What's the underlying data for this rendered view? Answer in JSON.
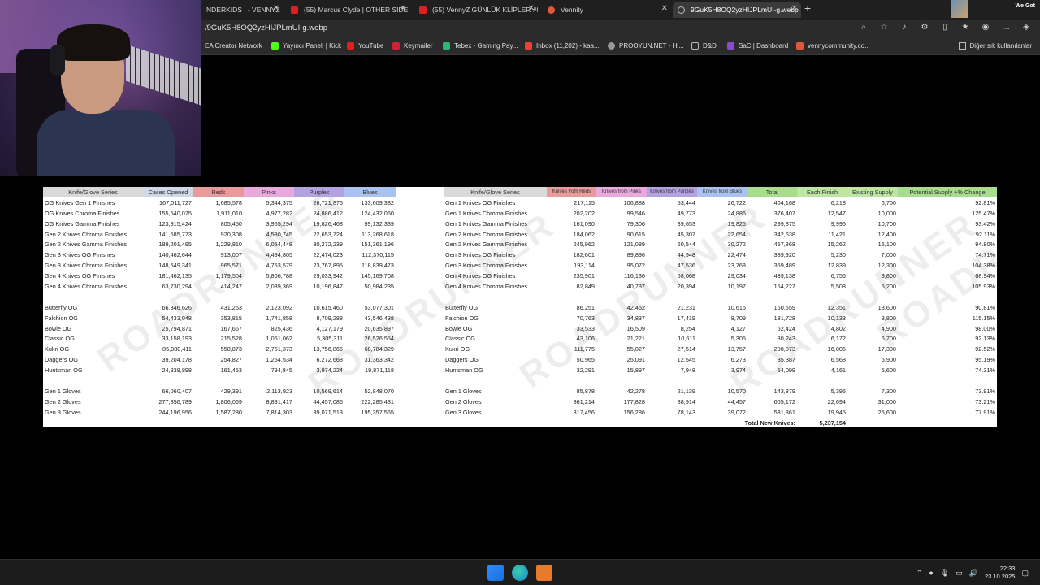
{
  "browser": {
    "tabs": [
      {
        "title": "NDERKIDS | - VENNYZ",
        "color": "#555"
      },
      {
        "title": "(55) Marcus Clyde | OTHER SIDE",
        "color": "#e02020"
      },
      {
        "title": "(55) VennyZ GÜNLÜK KLİPLER #8",
        "color": "#e02020"
      },
      {
        "title": "Vennity",
        "color": "#e05a3a"
      },
      {
        "title": "9GuK5H8OQ2yzHIJPLmUI-g.webp",
        "color": "#888"
      }
    ],
    "corner_text": "We Got",
    "url": "/9GuK5H8OQ2yzHIJPLmUI-g.webp",
    "bookmarks": [
      {
        "label": "EA Creator Network",
        "color": "#555"
      },
      {
        "label": "Yayıncı Paneli | Kick",
        "color": "#53fc18"
      },
      {
        "label": "YouTube",
        "color": "#e02020"
      },
      {
        "label": "Keymailer",
        "color": "#c23"
      },
      {
        "label": "Tebex - Gaming Pay...",
        "color": "#2bb673"
      },
      {
        "label": "Inbox (11,202) - kaa...",
        "color": "#ea4335"
      },
      {
        "label": "PROOYUN.NET - Hi...",
        "color": "#999"
      },
      {
        "label": "D&D",
        "color": "#888"
      },
      {
        "label": "SaC | Dashboard",
        "color": "#8a4bd1"
      },
      {
        "label": "vennycommunity.co...",
        "color": "#e05a3a"
      }
    ],
    "other_bookmarks": "Diğer sık kullanılanlar"
  },
  "sheet": {
    "left_headers": [
      "Knife/Glove Series",
      "Cases Opened",
      "Reds",
      "Pinks",
      "Purples",
      "Blues"
    ],
    "right_headers": [
      "Knife/Glove Series",
      "Knives from Reds",
      "Knives from Pinks",
      "Knives from Purples",
      "Knives from Blues",
      "Total",
      "Each Finish",
      "Existing Supply",
      "Potential Supply +% Change"
    ],
    "left_rows": [
      [
        "OG Knives Gen 1 Finishes",
        "167,011,727",
        "1,685,578",
        "5,344,375",
        "26,721,876",
        "133,609,382"
      ],
      [
        "OG Knives Chroma Finishes",
        "155,540,075",
        "1,911,010",
        "4,977,282",
        "24,886,412",
        "124,432,060"
      ],
      [
        "OG Knives Gamma Finishes",
        "123,915,424",
        "805,450",
        "3,965,294",
        "19,826,468",
        "99,132,339"
      ],
      [
        "Gen 2 Knives Chroma Finishes",
        "141,585,773",
        "920,308",
        "4,530,745",
        "22,653,724",
        "113,268,618"
      ],
      [
        "Gen 2 Knives Gamma Finishes",
        "189,201,495",
        "1,229,810",
        "6,054,448",
        "30,272,239",
        "151,361,196"
      ],
      [
        "Gen 3 Knives OG Finishes",
        "140,462,644",
        "913,007",
        "4,494,805",
        "22,474,023",
        "112,370,115"
      ],
      [
        "Gen 3 Knives Chroma Finishes",
        "148,549,341",
        "965,571",
        "4,753,579",
        "23,767,895",
        "118,839,473"
      ],
      [
        "Gen 4 Knives OG Finishes",
        "181,462,135",
        "1,179,504",
        "5,806,788",
        "29,033,942",
        "145,169,708"
      ],
      [
        "Gen 4 Knives Chroma Finishes",
        "63,730,294",
        "414,247",
        "2,039,369",
        "10,196,847",
        "50,984,235"
      ],
      [
        "",
        "",
        "",
        "",
        "",
        ""
      ],
      [
        "Butterfly OG",
        "66,346,626",
        "431,253",
        "2,123,092",
        "10,615,460",
        "53,077,301"
      ],
      [
        "Falchion OG",
        "54,433,048",
        "353,815",
        "1,741,858",
        "8,709,288",
        "43,546,438"
      ],
      [
        "Bowie OG",
        "25,794,871",
        "167,667",
        "825,436",
        "4,127,179",
        "20,635,897"
      ],
      [
        "Classic OG",
        "33,158,193",
        "215,528",
        "1,061,062",
        "5,305,311",
        "26,526,554"
      ],
      [
        "Kukri OG",
        "85,980,411",
        "558,873",
        "2,751,373",
        "13,756,866",
        "68,784,329"
      ],
      [
        "Daggers OG",
        "39,204,178",
        "254,827",
        "1,254,534",
        "6,272,668",
        "31,363,342"
      ],
      [
        "Huntsman OG",
        "24,838,898",
        "161,453",
        "794,845",
        "3,974,224",
        "19,871,118"
      ],
      [
        "",
        "",
        "",
        "",
        "",
        ""
      ],
      [
        "Gen 1 Gloves",
        "66,060,407",
        "429,391",
        "2,113,923",
        "10,569,614",
        "52,848,070"
      ],
      [
        "Gen 2 Gloves",
        "277,856,789",
        "1,806,069",
        "8,891,417",
        "44,457,086",
        "222,285,431"
      ],
      [
        "Gen 3 Gloves",
        "244,196,956",
        "1,587,280",
        "7,814,303",
        "39,071,513",
        "195,357,565"
      ]
    ],
    "right_rows": [
      [
        "Gen 1 Knives OG Finishes",
        "217,115",
        "106,888",
        "53,444",
        "26,722",
        "404,168",
        "6,218",
        "6,700",
        "92.81%"
      ],
      [
        "Gen 1 Knives Chroma Finishes",
        "202,202",
        "99,546",
        "49,773",
        "24,886",
        "376,407",
        "12,547",
        "10,000",
        "125.47%"
      ],
      [
        "Gen 1 Knives Gamma Finishes",
        "161,090",
        "79,306",
        "39,653",
        "19,826",
        "299,875",
        "9,996",
        "10,700",
        "93.42%"
      ],
      [
        "Gen 2 Knives Chroma Finishes",
        "184,062",
        "90,615",
        "45,307",
        "22,654",
        "342,638",
        "11,421",
        "12,400",
        "92.11%"
      ],
      [
        "Gen 2 Knives Gamma Finishes",
        "245,962",
        "121,089",
        "60,544",
        "30,272",
        "457,868",
        "15,262",
        "16,100",
        "94.80%"
      ],
      [
        "Gen 3 Knives OG Finishes",
        "182,601",
        "89,896",
        "44,948",
        "22,474",
        "339,920",
        "5,230",
        "7,000",
        "74.71%"
      ],
      [
        "Gen 3 Knives Chroma Finishes",
        "193,114",
        "95,072",
        "47,536",
        "23,768",
        "359,489",
        "12,839",
        "12,300",
        "104.38%"
      ],
      [
        "Gen 4 Knives OG Finishes",
        "235,901",
        "116,136",
        "58,068",
        "29,034",
        "439,138",
        "6,756",
        "9,800",
        "68.94%"
      ],
      [
        "Gen 4 Knives Chroma Finishes",
        "82,849",
        "40,787",
        "20,394",
        "10,197",
        "154,227",
        "5,508",
        "5,200",
        "105.93%"
      ],
      [
        "",
        "",
        "",
        "",
        "",
        "",
        "",
        "",
        ""
      ],
      [
        "Butterfly OG",
        "86,251",
        "42,462",
        "21,231",
        "10,615",
        "160,559",
        "12,351",
        "13,600",
        "90.81%"
      ],
      [
        "Falchion OG",
        "70,763",
        "34,837",
        "17,419",
        "8,709",
        "131,728",
        "10,133",
        "8,800",
        "115.15%"
      ],
      [
        "Bowie OG",
        "33,533",
        "16,509",
        "8,254",
        "4,127",
        "62,424",
        "4,802",
        "4,900",
        "98.00%"
      ],
      [
        "Classic OG",
        "43,106",
        "21,221",
        "10,611",
        "5,305",
        "80,243",
        "6,172",
        "6,700",
        "92.13%"
      ],
      [
        "Kukri OG",
        "111,775",
        "55,027",
        "27,514",
        "13,757",
        "208,073",
        "16,006",
        "17,300",
        "92.52%"
      ],
      [
        "Daggers OG",
        "50,965",
        "25,091",
        "12,545",
        "6,273",
        "85,387",
        "6,568",
        "6,900",
        "95.19%"
      ],
      [
        "Huntsman OG",
        "32,291",
        "15,897",
        "7,948",
        "3,974",
        "54,099",
        "4,161",
        "5,600",
        "74.31%"
      ],
      [
        "",
        "",
        "",
        "",
        "",
        "",
        "",
        "",
        ""
      ],
      [
        "Gen 1 Gloves",
        "85,878",
        "42,278",
        "21,139",
        "10,570",
        "143,879",
        "5,395",
        "7,300",
        "73.91%"
      ],
      [
        "Gen 2 Gloves",
        "361,214",
        "177,828",
        "88,914",
        "44,457",
        "605,172",
        "22,694",
        "31,000",
        "73.21%"
      ],
      [
        "Gen 3 Gloves",
        "317,456",
        "156,286",
        "78,143",
        "39,072",
        "531,861",
        "19,945",
        "25,600",
        "77.91%"
      ]
    ],
    "total_label": "Total New Knives:",
    "total_value": "5,237,154"
  },
  "taskbar": {
    "time": "22:33",
    "date": "23.10.2025"
  }
}
